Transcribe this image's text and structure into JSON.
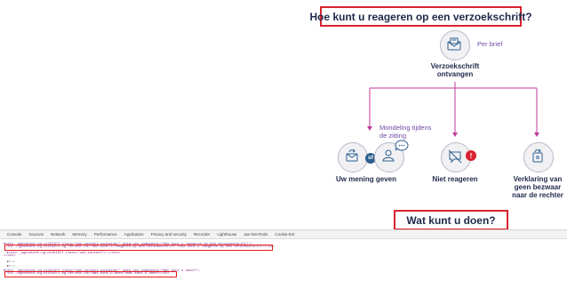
{
  "infographic": {
    "title": "Hoe kunt u reageren op een verzoekschrift?",
    "per_brief": "Per brief",
    "received": [
      "Verzoekschrift",
      "ontvangen"
    ],
    "hearing": [
      "Mondeling tijdens",
      "de zitting"
    ],
    "or_label": "of",
    "option_opinion": "Uw mening geven",
    "option_no_reaction": "Niet reageren",
    "option_statement": [
      "Verklaring van",
      "geen bezwaar",
      "naar de rechter"
    ],
    "section_title": "Wat kunt u doen?",
    "colors": {
      "accent_red": "#d9222f",
      "purple": "#c2399a",
      "navy": "#1e2a4a",
      "icon_blue": "#2d5f8f"
    }
  },
  "devtools": {
    "tabs": [
      "Console",
      "Sources",
      "Network",
      "Memory",
      "Performance",
      "Application",
      "Privacy and security",
      "Recorder",
      "Lighthouse",
      "axe DevTools",
      "Cookie-Ext"
    ],
    "code_lines": [
      "▾<div _ngcontent-ng-c1151871 class=\"sub-content-container\" data-ves-component=\"Hoe kunt u reageren op een verzoekschrift?\">",
      "<h2 _ngcontent-ng-c1151871 ng-reflect-id=\"hoe-kunt-u-reageren-op-een-verzoekschrift\">Hoe kunt u reageren op een verzoekschrift?</h2>",
      "▸<div _ngcontent-ng-c1151871 class=\"sub-content\">…</div>",
      "</div>",
      "▸<…>",
      "▸<…>",
      "▾<div _ngcontent-ng-c1151871 class=\"sub-content-container\" data-ves-component=\"Wat kunt u doen?\">",
      "<h2 _ngcontent-ng-c1151871 ng-reflect-id=\"wat-kunt-u-doen\">Wat kunt u doen?</h2>"
    ]
  }
}
